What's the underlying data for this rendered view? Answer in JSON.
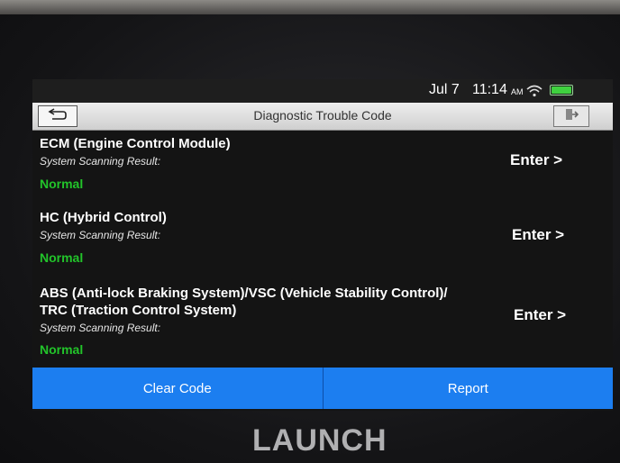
{
  "status": {
    "date": "Jul 7",
    "time": "11:14",
    "ampm": "AM"
  },
  "header": {
    "title": "Diagnostic Trouble Code"
  },
  "systems": [
    {
      "name_lines": [
        "ECM (Engine Control Module)"
      ],
      "result_label": "System Scanning Result:",
      "result": "Normal",
      "action": "Enter >"
    },
    {
      "name_lines": [
        "HC (Hybrid Control)"
      ],
      "result_label": "System Scanning Result:",
      "result": "Normal",
      "action": "Enter >"
    },
    {
      "name_lines": [
        "ABS (Anti-lock Braking System)/VSC (Vehicle Stability Control)/",
        "TRC (Traction Control System)"
      ],
      "result_label": "System Scanning Result:",
      "result": "Normal",
      "action": "Enter >"
    }
  ],
  "footer": {
    "clear_label": "Clear Code",
    "report_label": "Report"
  },
  "device": {
    "brand": "LAUNCH"
  },
  "colors": {
    "accent": "#1c7ef0",
    "status_ok": "#22c42a"
  }
}
